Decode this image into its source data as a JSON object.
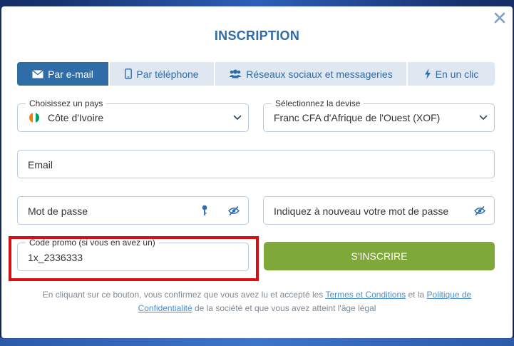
{
  "modal": {
    "title": "INSCRIPTION"
  },
  "tabs": [
    {
      "label": "Par e-mail",
      "icon": "envelope-icon",
      "active": true
    },
    {
      "label": "Par téléphone",
      "icon": "phone-icon",
      "active": false
    },
    {
      "label": "Réseaux sociaux et messageries",
      "icon": "users-icon",
      "active": false
    },
    {
      "label": "En un clic",
      "icon": "lightning-icon",
      "active": false
    }
  ],
  "country": {
    "legend": "Choisissez un pays",
    "value": "Côte d'Ivoire",
    "flag_colors": [
      "#f77f00",
      "#ffffff",
      "#009e60"
    ]
  },
  "currency": {
    "legend": "Sélectionnez la devise",
    "value": "Franc CFA d'Afrique de l'Ouest (XOF)"
  },
  "email": {
    "placeholder": "Email"
  },
  "password": {
    "placeholder": "Mot de passe"
  },
  "password_confirm": {
    "placeholder": "Indiquez à nouveau votre mot de passe"
  },
  "promo": {
    "legend": "Code promo (si vous en avez un)",
    "value": "1x_2336333"
  },
  "submit": {
    "label": "S'INSCRIRE"
  },
  "legal": {
    "text_1": "En cliquant sur ce bouton, vous confirmez que vous avez lu et accepté les ",
    "link_terms": "Termes et Conditions",
    "text_2": " et la ",
    "link_privacy_1": "Politique de",
    "link_privacy_2": "Confidentialité",
    "text_3": " de la société et que vous avez atteint l'âge légal"
  },
  "colors": {
    "accent": "#2f6ca8",
    "submit": "#7fa83b",
    "highlight": "#d50f14"
  }
}
